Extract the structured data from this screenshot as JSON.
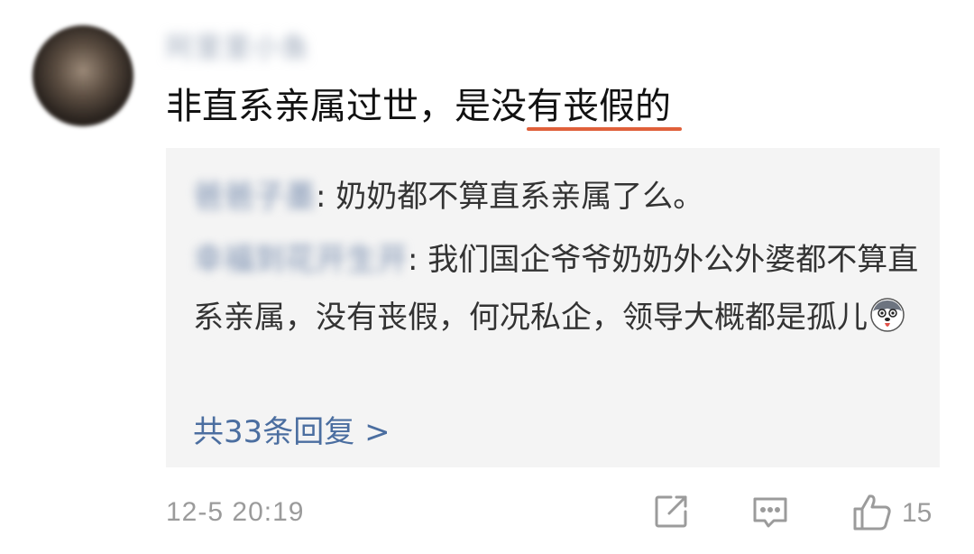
{
  "comment": {
    "author": "阿里里小鱼",
    "text": "非直系亲属过世，是没有丧假的",
    "timestamp": "12-5 20:19",
    "like_count": "15"
  },
  "replies": [
    {
      "author": "爸爸子墨",
      "separator": ": ",
      "text": "奶奶都不算直系亲属了么。"
    },
    {
      "author": "幸福到花开生开",
      "separator": ": ",
      "text": "我们国企爷爷奶奶外公外婆都不算直系亲属，没有丧假，何况私企，领导大概都是孤儿"
    }
  ],
  "more_replies": "共33条回复 >",
  "icons": {
    "share": "share-icon",
    "comment": "comment-icon",
    "like": "thumbs-up-icon",
    "emoji": "husky-emoji-icon"
  },
  "colors": {
    "link": "#4b6ea0",
    "underline": "#e0603a",
    "reply_bg": "#f4f4f4"
  }
}
